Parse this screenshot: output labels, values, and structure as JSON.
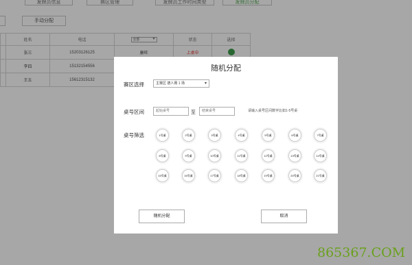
{
  "nav_tabs": [
    "发牌员信息",
    "赛区管理",
    "发牌员工作时间类型",
    "发牌员分配"
  ],
  "manual_button": "手动分配",
  "table": {
    "headers": [
      "姓名",
      "电话",
      "",
      "状态",
      "选择"
    ],
    "filter_value": "全部",
    "rows": [
      {
        "name": "张三",
        "phone": "15203126125",
        "extra": "康旺",
        "status": "上桌中"
      },
      {
        "name": "李四",
        "phone": "15132154556",
        "extra": "",
        "status": ""
      },
      {
        "name": "王五",
        "phone": "15612315132",
        "extra": "",
        "status": ""
      }
    ]
  },
  "modal": {
    "title": "随机分配",
    "zone_label": "赛区选择",
    "zone_value": "主赛区 德人赛 1 场",
    "range_label": "桌号区间",
    "start_placeholder": "起始桌号",
    "to_text": "至",
    "end_placeholder": "结束桌号",
    "hint": "请输入桌号区间数字比如1-5号桌",
    "filter_label": "桌号筛选",
    "tables": [
      [
        "1号桌",
        "2号桌",
        "3号桌",
        "4号桌",
        "5号桌",
        "6号桌",
        "7号桌"
      ],
      [
        "8号桌",
        "9号桌",
        "10号桌",
        "11号桌",
        "12号桌",
        "13号桌",
        "14号桌"
      ],
      [
        "15号桌",
        "16号桌",
        "17号桌",
        "18号桌",
        "19号桌",
        "20号桌",
        "21号桌"
      ]
    ],
    "random_button": "随机分配",
    "cancel_button": "取消"
  },
  "watermark": "865367.COM",
  "colors": {
    "accent_green": "#3a9a3a",
    "status_red": "#dd2222",
    "select_dot": "#1a8a2a"
  }
}
